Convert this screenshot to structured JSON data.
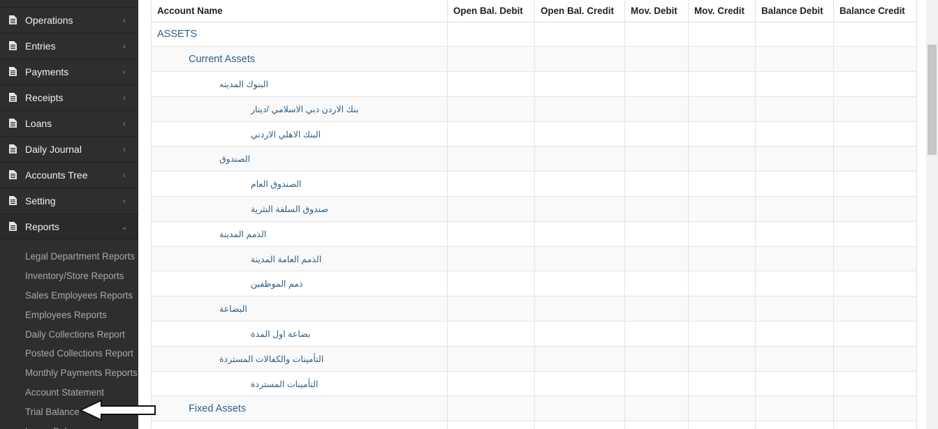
{
  "sidebar": {
    "menu": [
      {
        "label": "Operations"
      },
      {
        "label": "Entries"
      },
      {
        "label": "Payments"
      },
      {
        "label": "Receipts"
      },
      {
        "label": "Loans"
      },
      {
        "label": "Daily Journal"
      },
      {
        "label": "Accounts Tree"
      },
      {
        "label": "Setting"
      },
      {
        "label": "Reports"
      }
    ],
    "reports_submenu": [
      {
        "label": "Legal Department Reports"
      },
      {
        "label": "Inventory/Store Reports"
      },
      {
        "label": "Sales Employees Reports"
      },
      {
        "label": "Employees Reports"
      },
      {
        "label": "Daily Collections Report"
      },
      {
        "label": "Posted Collections Report"
      },
      {
        "label": "Monthly Payments Reports"
      },
      {
        "label": "Account Statement"
      },
      {
        "label": "Trial Balance"
      },
      {
        "label": "Loans Balance"
      }
    ],
    "icons": {
      "collapsed": "chevron-left-icon",
      "expanded": "chevron-down-icon",
      "item": "document-icon"
    }
  },
  "table": {
    "headers": [
      "Account Name",
      "Open Bal. Debit",
      "Open Bal. Credit",
      "Mov. Debit",
      "Mov. Credit",
      "Balance Debit",
      "Balance Credit"
    ],
    "rows": [
      {
        "name": "ASSETS",
        "level": 0
      },
      {
        "name": "Current Assets",
        "level": 1
      },
      {
        "name": "البنوك المدينه",
        "level": 2
      },
      {
        "name": "بنك الاردن دبي الاسلامي /دينار",
        "level": 3
      },
      {
        "name": "البنك الاهلي الاردني",
        "level": 3
      },
      {
        "name": "الصندوق",
        "level": 2
      },
      {
        "name": "الصندوق العام",
        "level": 3
      },
      {
        "name": "صندوق السلفة النثرية",
        "level": 3
      },
      {
        "name": "الذمم المدينة",
        "level": 2
      },
      {
        "name": "الذمم العامة المدينة",
        "level": 3
      },
      {
        "name": "ذمم الموظفين",
        "level": 3
      },
      {
        "name": "البضاعة",
        "level": 2
      },
      {
        "name": "بضاعة اول المدة",
        "level": 3
      },
      {
        "name": "التأمينات والكفالات المستردة",
        "level": 2
      },
      {
        "name": "التأمينات المستردة",
        "level": 3
      },
      {
        "name": "Fixed Assets",
        "level": 1
      },
      {
        "name": "",
        "level": 1
      }
    ]
  },
  "colors": {
    "sidebar_bg": "#2e2e2e",
    "link_blue": "#2c5f8a",
    "row_stripe": "#f9f9f9"
  }
}
